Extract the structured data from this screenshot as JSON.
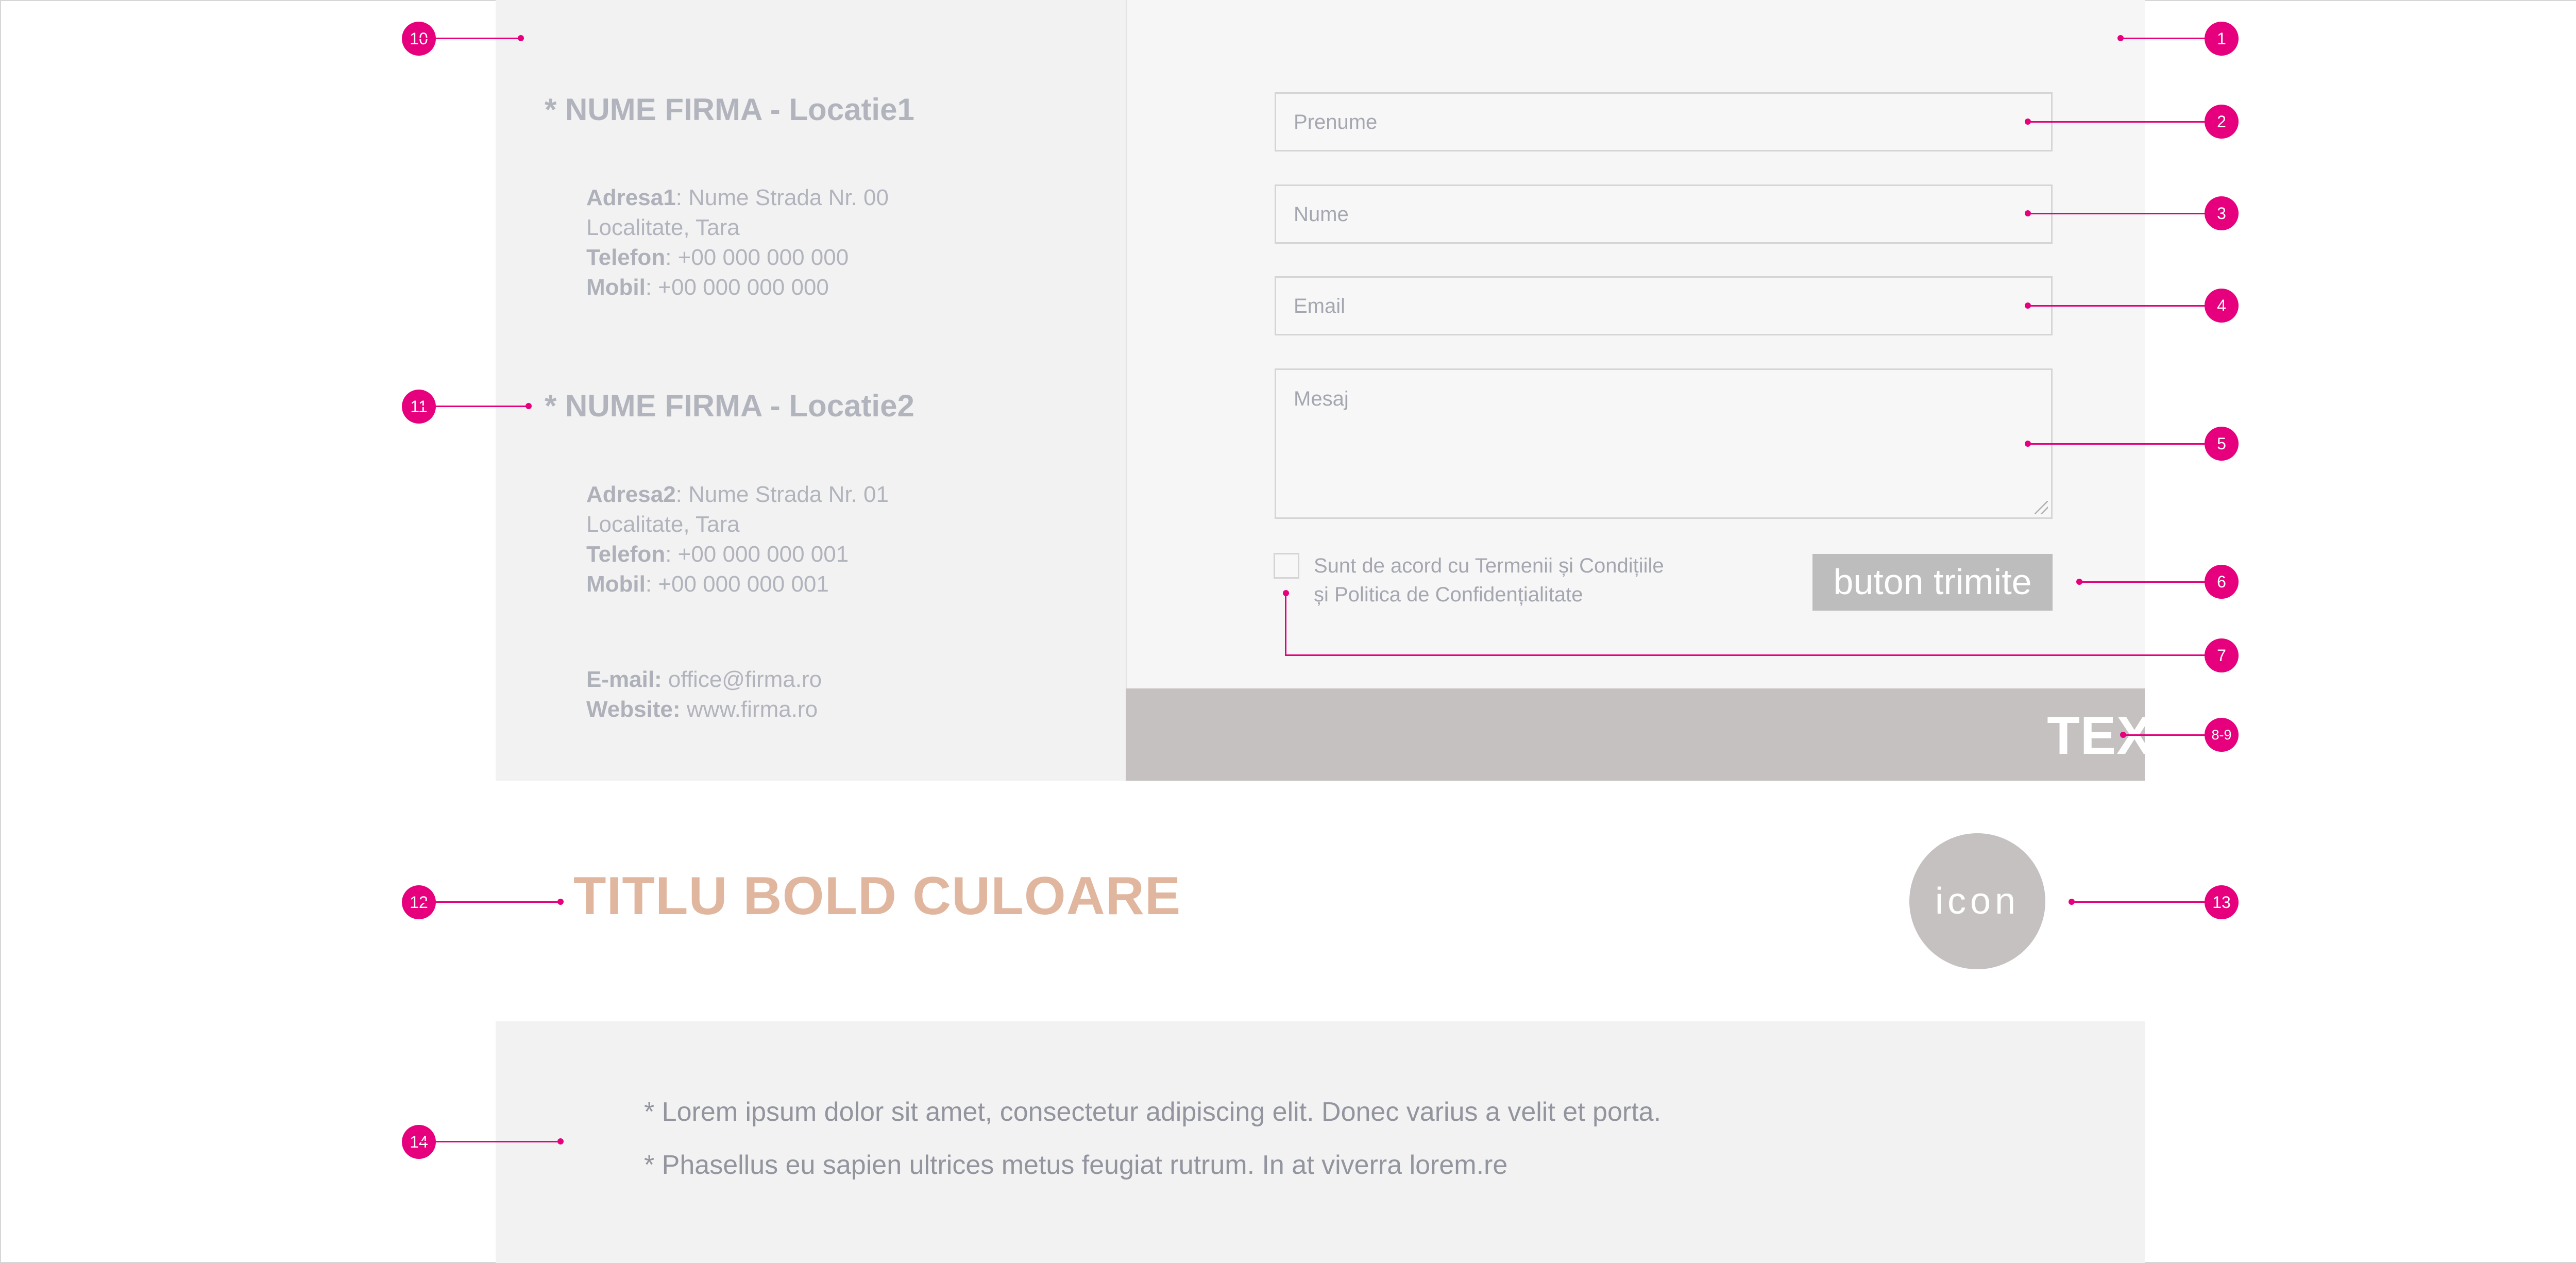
{
  "left": {
    "location1": {
      "title": "* NUME FIRMA - Locatie1",
      "address_label": "Adresa1",
      "address_value": ": Nume Strada Nr. 00",
      "city": "Localitate, Tara",
      "phone_label": "Telefon",
      "phone_value": ": +00 000 000 000",
      "mobile_label": "Mobil",
      "mobile_value": ": +00 000 000 000"
    },
    "location2": {
      "title": "* NUME FIRMA - Locatie2",
      "address_label": "Adresa2",
      "address_value": ": Nume Strada Nr. 01",
      "city": "Localitate, Tara",
      "phone_label": "Telefon",
      "phone_value": ": +00 000 000 001",
      "mobile_label": "Mobil",
      "mobile_value": ": +00 000 000 001"
    },
    "contact": {
      "email_label": "E-mail:",
      "email_value": " office@firma.ro",
      "website_label": "Website:",
      "website_value": " www.firma.ro"
    }
  },
  "form": {
    "first_name_placeholder": "Prenume",
    "last_name_placeholder": "Nume",
    "email_placeholder": "Email",
    "message_placeholder": "Mesaj",
    "terms_line1": "Sunt de acord cu Termenii și Condițiile",
    "terms_line2": "și Politica de Confidențialitate",
    "submit_label": "buton trimite"
  },
  "promo": {
    "text": "TEXT PROMO BOLD!"
  },
  "section": {
    "title": "TITLU BOLD CULOARE",
    "icon_label": "icon"
  },
  "bottom": {
    "items": [
      "* Lorem ipsum dolor sit amet, consectetur adipiscing elit. Donec varius a velit et porta.",
      "* Phasellus eu sapien ultrices metus feugiat rutrum. In at viverra lorem.re"
    ]
  },
  "annotations": [
    "1",
    "2",
    "3",
    "4",
    "5",
    "6",
    "7",
    "8-9",
    "10",
    "11",
    "12",
    "13",
    "14"
  ],
  "colors": {
    "annotation": "#e6007e",
    "title_accent": "#e0b69e",
    "promo_bar": "#c5c1c0",
    "submit_button": "#bdbdbd",
    "panel": "#f2f2f2"
  }
}
